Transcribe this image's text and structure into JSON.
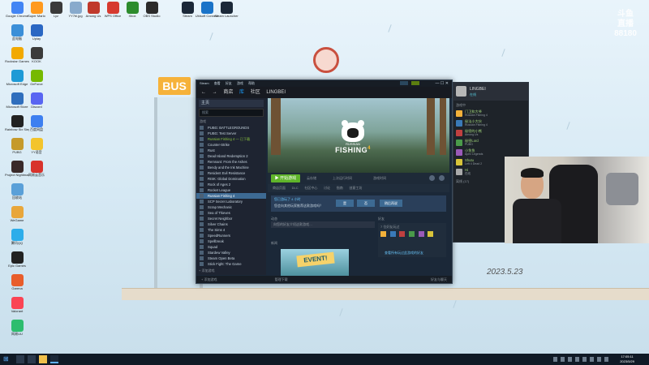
{
  "desktop": {
    "wallpaper_sign": "BUS",
    "corner_logo": "斗鱼\n直播\n88180",
    "signature": "2023.5.23",
    "icons": [
      {
        "label": "Google Chrome",
        "color": "#4285f4"
      },
      {
        "label": "Super Mario",
        "color": "#ff9a1f"
      },
      {
        "label": "Lyz",
        "color": "#3a3a3a"
      },
      {
        "label": "YY7bl.jpg",
        "color": "#88aacc"
      },
      {
        "label": "Among Us",
        "color": "#c0392b"
      },
      {
        "label": "WPS Office",
        "color": "#d63a2f"
      },
      {
        "label": "Xbox",
        "color": "#2d8c2d"
      },
      {
        "label": "OBS Studio",
        "color": "#2b2b2b"
      },
      {
        "label": "Steam",
        "color": "#1b2838"
      },
      {
        "label": "Ubisoft Connect",
        "color": "#1a73c8"
      },
      {
        "label": "Steam Launcher",
        "color": "#1b2838"
      },
      {
        "label": "此电脑",
        "color": "#3b8fd8"
      },
      {
        "label": "Rockstar Games",
        "color": "#f2a900"
      },
      {
        "label": "Microsoft Edge",
        "color": "#1e9ad6"
      },
      {
        "label": "Microsoft Store",
        "color": "#2f6ebd"
      },
      {
        "label": "Rainbow Six Siege",
        "color": "#222"
      },
      {
        "label": "PUBG",
        "color": "#c59a2b"
      },
      {
        "label": "Project Nightmares",
        "color": "#3a2a2a"
      },
      {
        "label": "回收站",
        "color": "#5aa0d8"
      },
      {
        "label": "WeGame",
        "color": "#e8a63a"
      },
      {
        "label": "腾讯QQ",
        "color": "#2dadea"
      },
      {
        "label": "Epic Games",
        "color": "#222"
      },
      {
        "label": "Garena",
        "color": "#e85d2b"
      },
      {
        "label": "Valorant",
        "color": "#fa4454"
      },
      {
        "label": "网易UU",
        "color": "#2dbd6e"
      },
      {
        "label": "Uplay",
        "color": "#2a67c3"
      },
      {
        "label": "KOOK",
        "color": "#3b3b3b"
      },
      {
        "label": "GeForce",
        "color": "#76b900"
      },
      {
        "label": "Discord",
        "color": "#5865f2"
      },
      {
        "label": "百度网盘",
        "color": "#3d7ff0"
      },
      {
        "label": "YY语音",
        "color": "#f3c42c"
      },
      {
        "label": "网易云音乐",
        "color": "#d8332c"
      }
    ]
  },
  "steam": {
    "menu": [
      "Steam",
      "查看",
      "好友",
      "游戏",
      "帮助"
    ],
    "account": "LINGBEI",
    "nav": [
      "商店",
      "库",
      "社区",
      "LINGBEI"
    ],
    "sidebar": {
      "home": "主页",
      "search": "搜索",
      "category": "游戏",
      "games": [
        "PUBG: BATTLEGROUNDS",
        "PUBG: Test Server",
        "Russian Fishing 4 — 已下载",
        "Counter-Strike",
        "Rust",
        "Dead Island Redemption 2",
        "Remnant: From the Ashes",
        "Bendy and the Ink Machine",
        "Resident Evil Resistance",
        "RISK: Global Domination",
        "Rock of Ages 2",
        "Rocket League",
        "Russian Fishing 4",
        "SCP Secret Laboratory",
        "Scrap Mechanic",
        "Sea of Thieves",
        "Secret Neighbor",
        "Silver Chains",
        "The Sims 4",
        "SpeedRunners",
        "Spellbreak",
        "Squad",
        "Stardew Valley",
        "Steam Open Beta",
        "Stick Fight: The Game"
      ],
      "add_game": "+ 添加游戏"
    },
    "game": {
      "title_small": "RUSSIAN",
      "title": "FISHING",
      "number": "4",
      "play": "▶ 开始游戏",
      "stats": [
        "云存储",
        "上次运行时间",
        "游戏时间"
      ],
      "tabs": [
        "商店页面",
        "DLC",
        "社区中心",
        "讨论",
        "指南",
        "创意工坊"
      ],
      "review_title": "您已游玩了 4 小时",
      "review_sub": "您会向其他玩家推荐这款游戏吗？",
      "review_buttons": [
        "是",
        "否",
        "稍后再说"
      ],
      "activity": "动态",
      "comment_placeholder": "向您的好友介绍这款游戏…",
      "news": "新闻",
      "news_event": "EVENT!",
      "friends_title": "好友",
      "friends_sub": "7 位好友玩过",
      "friends_view_all": "查看所有玩过此游戏的好友",
      "footer": "管理下载",
      "footer_friends": "好友与聊天"
    }
  },
  "friends_panel": {
    "user": "LINGBEI",
    "status": "在线",
    "section": "游戏中",
    "friends": [
      {
        "name": "门卫和大爷",
        "status": "Russian Fishing 4",
        "color": "#f3b13a"
      },
      {
        "name": "秘法小大伙",
        "status": "Russian Fishing 4",
        "color": "#3a7ab8"
      },
      {
        "name": "秘密的小熊",
        "status": "Among Us",
        "color": "#c04040"
      },
      {
        "name": "秘密Lord",
        "status": "PUBG",
        "color": "#4a9a4a"
      },
      {
        "name": "小鱼鱼",
        "status": "Apex Legends",
        "color": "#9a5ab8"
      },
      {
        "name": "Shutu",
        "status": "Left 4 Dead 2",
        "color": "#d8c43a"
      },
      {
        "name": "Hi",
        "status": "在线",
        "color": "#aaaaaa"
      }
    ],
    "offline_section": "离线 (17)"
  },
  "taskbar": {
    "time": "17:05:11",
    "date": "2023/5/29"
  }
}
